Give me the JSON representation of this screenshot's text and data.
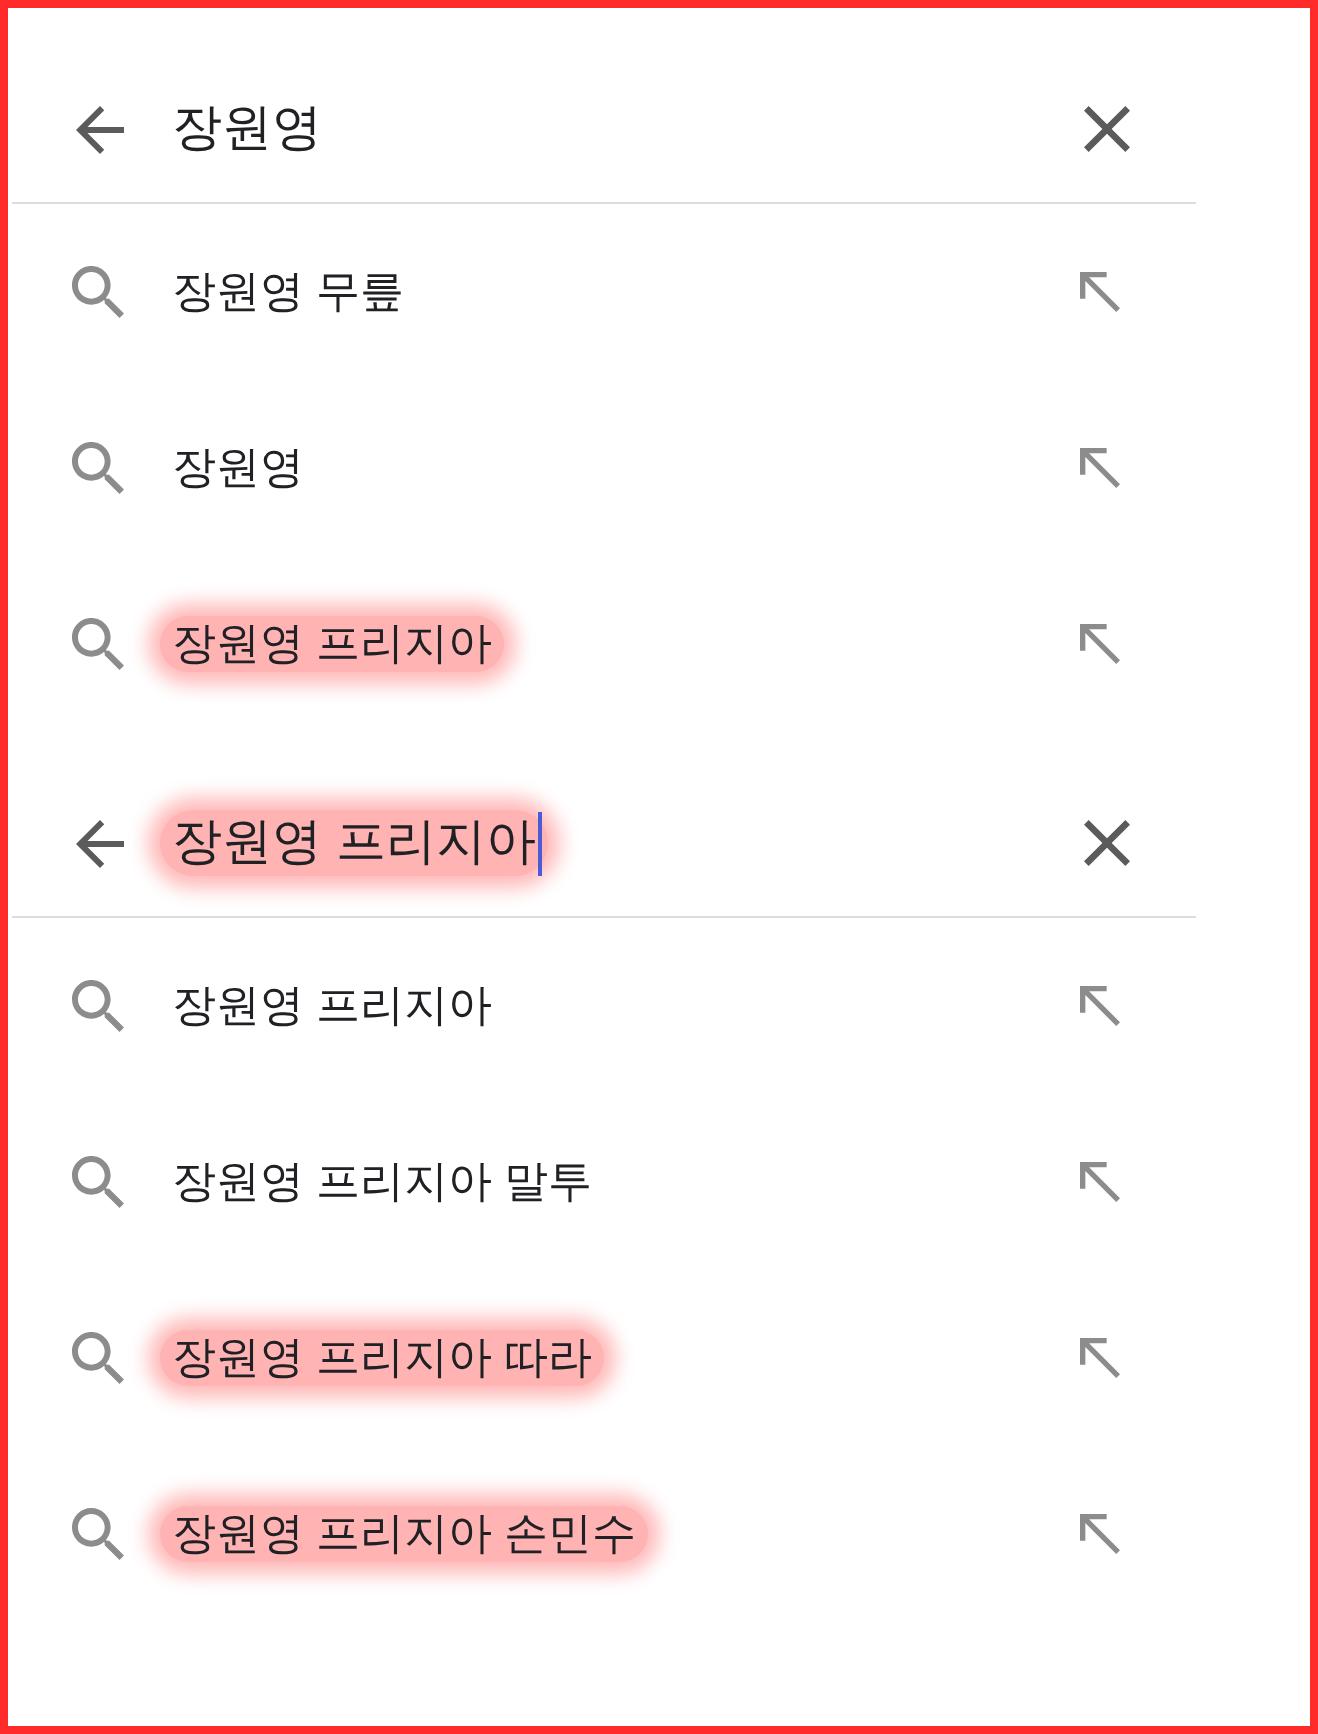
{
  "panels": [
    {
      "search": {
        "value": "장원영",
        "highlighted": false,
        "focused": false
      },
      "suggestions": [
        {
          "text": "장원영 무릎",
          "highlighted": false
        },
        {
          "text": "장원영",
          "highlighted": false
        },
        {
          "text": "장원영 프리지아",
          "highlighted": true
        }
      ]
    },
    {
      "search": {
        "value": "장원영 프리지아",
        "highlighted": true,
        "focused": true
      },
      "suggestions": [
        {
          "text": "장원영 프리지아",
          "highlighted": false
        },
        {
          "text": "장원영 프리지아 말투",
          "highlighted": false
        },
        {
          "text": "장원영 프리지아 따라",
          "highlighted": true
        },
        {
          "text": "장원영 프리지아 손민수",
          "highlighted": true
        }
      ]
    }
  ]
}
